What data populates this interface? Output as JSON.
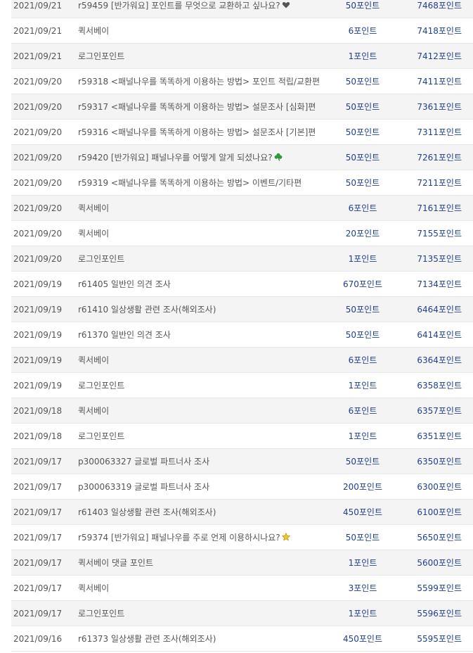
{
  "rows": [
    {
      "date": "2021/09/21",
      "description": "r59459 [반가워요] 포인트를 무엇으로 교환하고 싶나요?",
      "icon": "heart-icon",
      "earned": "50포인트",
      "balance": "7468포인트"
    },
    {
      "date": "2021/09/21",
      "description": "퀵서베이",
      "icon": "",
      "earned": "6포인트",
      "balance": "7418포인트"
    },
    {
      "date": "2021/09/21",
      "description": "로그인포인트",
      "icon": "",
      "earned": "1포인트",
      "balance": "7412포인트"
    },
    {
      "date": "2021/09/20",
      "description": "r59318 <패널나우를 똑똑하게 이용하는 방법> 포인트 적립/교환편",
      "icon": "",
      "earned": "50포인트",
      "balance": "7411포인트"
    },
    {
      "date": "2021/09/20",
      "description": "r59317 <패널나우를 똑똑하게 이용하는 방법> 설문조사 [심화]편",
      "icon": "",
      "earned": "50포인트",
      "balance": "7361포인트"
    },
    {
      "date": "2021/09/20",
      "description": "r59316 <패널나우를 똑똑하게 이용하는 방법> 설문조사 [기본]편",
      "icon": "",
      "earned": "50포인트",
      "balance": "7311포인트"
    },
    {
      "date": "2021/09/20",
      "description": "r59420 [반가워요] 패널나우를 어떻게 알게 되셨나요?",
      "icon": "clover-icon",
      "earned": "50포인트",
      "balance": "7261포인트"
    },
    {
      "date": "2021/09/20",
      "description": "r59319 <패널나우를 똑똑하게 이용하는 방법> 이벤트/기타편",
      "icon": "",
      "earned": "50포인트",
      "balance": "7211포인트"
    },
    {
      "date": "2021/09/20",
      "description": "퀵서베이",
      "icon": "",
      "earned": "6포인트",
      "balance": "7161포인트"
    },
    {
      "date": "2021/09/20",
      "description": "퀵서베이",
      "icon": "",
      "earned": "20포인트",
      "balance": "7155포인트"
    },
    {
      "date": "2021/09/20",
      "description": "로그인포인트",
      "icon": "",
      "earned": "1포인트",
      "balance": "7135포인트"
    },
    {
      "date": "2021/09/19",
      "description": "r61405 일반인 의견 조사",
      "icon": "",
      "earned": "670포인트",
      "balance": "7134포인트"
    },
    {
      "date": "2021/09/19",
      "description": "r61410 일상생활 관련 조사(해외조사)",
      "icon": "",
      "earned": "50포인트",
      "balance": "6464포인트"
    },
    {
      "date": "2021/09/19",
      "description": "r61370 일반인 의견 조사",
      "icon": "",
      "earned": "50포인트",
      "balance": "6414포인트"
    },
    {
      "date": "2021/09/19",
      "description": "퀵서베이",
      "icon": "",
      "earned": "6포인트",
      "balance": "6364포인트"
    },
    {
      "date": "2021/09/19",
      "description": "로그인포인트",
      "icon": "",
      "earned": "1포인트",
      "balance": "6358포인트"
    },
    {
      "date": "2021/09/18",
      "description": "퀵서베이",
      "icon": "",
      "earned": "6포인트",
      "balance": "6357포인트"
    },
    {
      "date": "2021/09/18",
      "description": "로그인포인트",
      "icon": "",
      "earned": "1포인트",
      "balance": "6351포인트"
    },
    {
      "date": "2021/09/17",
      "description": "p300063327 글로벌 파트너사 조사",
      "icon": "",
      "earned": "50포인트",
      "balance": "6350포인트"
    },
    {
      "date": "2021/09/17",
      "description": "p300063319 글로벌 파트너사 조사",
      "icon": "",
      "earned": "200포인트",
      "balance": "6300포인트"
    },
    {
      "date": "2021/09/17",
      "description": "r61403 일상생활 관련 조사(해외조사)",
      "icon": "",
      "earned": "450포인트",
      "balance": "6100포인트"
    },
    {
      "date": "2021/09/17",
      "description": "r59374 [반가워요] 패널나우를 주로 언제 이용하시나요?",
      "icon": "star-icon",
      "earned": "50포인트",
      "balance": "5650포인트"
    },
    {
      "date": "2021/09/17",
      "description": "퀵서베이 댓글 포인트",
      "icon": "",
      "earned": "1포인트",
      "balance": "5600포인트"
    },
    {
      "date": "2021/09/17",
      "description": "퀵서베이",
      "icon": "",
      "earned": "3포인트",
      "balance": "5599포인트"
    },
    {
      "date": "2021/09/17",
      "description": "로그인포인트",
      "icon": "",
      "earned": "1포인트",
      "balance": "5596포인트"
    },
    {
      "date": "2021/09/16",
      "description": "r61373 일상생활 관련 조사(해외조사)",
      "icon": "",
      "earned": "450포인트",
      "balance": "5595포인트"
    }
  ]
}
